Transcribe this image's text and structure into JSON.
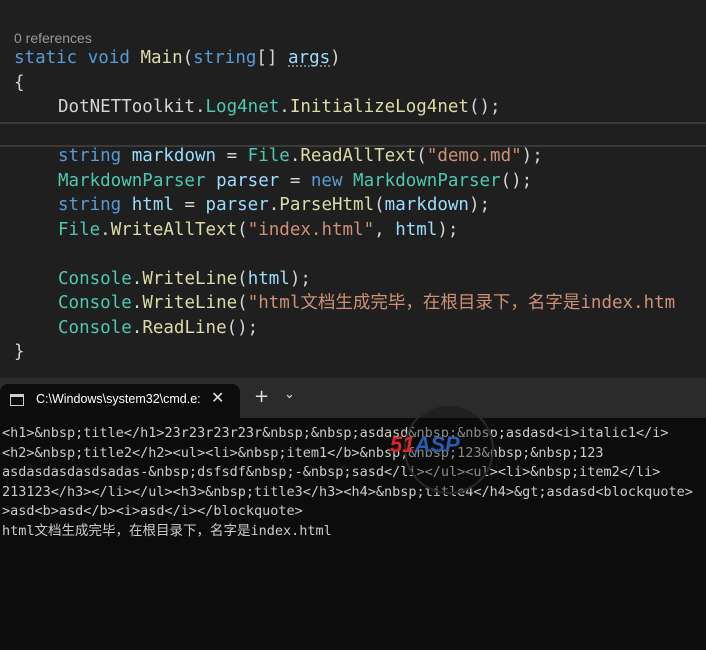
{
  "editor": {
    "codelens": "0 references",
    "lines": {
      "sig": {
        "static": "static",
        "void": "void",
        "main": "Main",
        "p1": "(",
        "string": "string",
        "p2": "[] ",
        "args": "args",
        "p3": ")"
      },
      "open_brace": "{",
      "init": {
        "cls": "DotNETToolkit",
        "dot1": ".",
        "ns": "Log4net",
        "dot2": ".",
        "method": "InitializeLog4net",
        "tail": "();"
      },
      "md": {
        "type": "string",
        "var": "markdown",
        "eq": " = ",
        "cls": "File",
        "dot": ".",
        "method": "ReadAllText",
        "p1": "(",
        "arg": "\"demo.md\"",
        "p2": ");"
      },
      "parser": {
        "type": "MarkdownParser",
        "var": "parser",
        "eq": " = ",
        "kw": "new",
        "type2": "MarkdownParser",
        "tail": "();"
      },
      "html": {
        "type": "string",
        "var": "html",
        "eq": " = ",
        "obj": "parser",
        "dot": ".",
        "method": "ParseHtml",
        "p1": "(",
        "arg": "markdown",
        "p2": ");"
      },
      "write": {
        "cls": "File",
        "dot": ".",
        "method": "WriteAllText",
        "p1": "(",
        "arg1": "\"index.html\"",
        "comma": ", ",
        "arg2": "html",
        "p2": ");"
      },
      "cw1": {
        "cls": "Console",
        "dot": ".",
        "method": "WriteLine",
        "p1": "(",
        "arg": "html",
        "p2": ");"
      },
      "cw2": {
        "cls": "Console",
        "dot": ".",
        "method": "WriteLine",
        "p1": "(",
        "arg": "\"html文档生成完毕，在根目录下，名字是index.htm"
      },
      "rl": {
        "cls": "Console",
        "dot": ".",
        "method": "ReadLine",
        "tail": "();"
      },
      "close_brace": "}"
    }
  },
  "terminal": {
    "tab_title": "C:\\Windows\\system32\\cmd.e:",
    "close_glyph": "✕",
    "new_tab_glyph": "+",
    "dropdown_glyph": "⌄",
    "output": [
      "<h1>&nbsp;title</h1>23r23r23r23r&nbsp;&nbsp;asdasd&nbsp;&nbsp;asdasd<i>italic1</i>",
      "<h2>&nbsp;title2</h2><ul><li>&nbsp;item1</b>&nbsp;&nbsp;123&nbsp;&nbsp;123",
      "asdasdasdasdsadas-&nbsp;dsfsdf&nbsp;-&nbsp;sasd</li></ul><ul><li>&nbsp;item2</li>",
      "213123</h3></li></ul><h3>&nbsp;title3</h3><h4>&nbsp;title4</h4>&gt;asdasd<blockquote>",
      ">asd<b>asd</b><i>asd</i></blockquote>",
      "html文档生成完毕，在根目录下，名字是index.html"
    ]
  },
  "watermark": {
    "text_red": "51",
    "text_blue": "ASP"
  },
  "colors": {
    "keyword": "#569cd6",
    "type": "#4ec9b0",
    "method": "#dcdcaa",
    "string": "#ce9178",
    "identifier": "#9cdcfe",
    "terminal_bg": "#0c0c0c",
    "editor_bg": "#1f1f1f"
  }
}
